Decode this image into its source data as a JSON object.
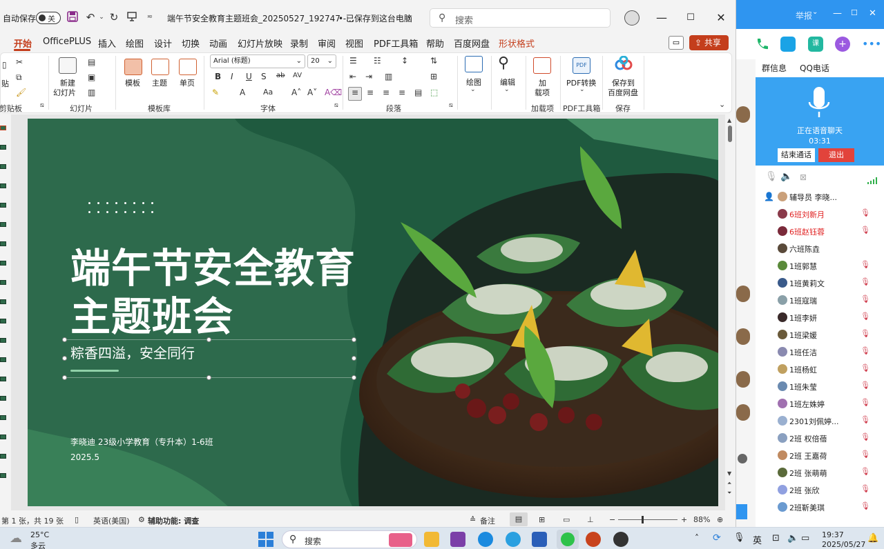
{
  "titlebar": {
    "autosave_label": "自动保存",
    "autosave_state": "关",
    "doc_title": "端午节安全教育主题班会_20250527_192747  -...",
    "save_status": "• 已保存到这台电脑",
    "search_placeholder": "搜索"
  },
  "tabs": [
    "开始",
    "OfficePLUS",
    "插入",
    "绘图",
    "设计",
    "切换",
    "动画",
    "幻灯片放映",
    "录制",
    "审阅",
    "视图",
    "PDF工具箱",
    "帮助",
    "百度网盘",
    "形状格式"
  ],
  "share_label": "共享",
  "ribbon": {
    "paste_label": "贴",
    "new_slide_label": "新建",
    "new_slide_label2": "幻灯片",
    "template_label": "模板",
    "theme_label": "主题",
    "single_page_label": "单页",
    "font_name": "Arial (标题)",
    "font_size": "20",
    "drawing_label": "绘图",
    "edit_label": "编辑",
    "addin_label": "加",
    "addin_label2": "载项",
    "pdf_convert_label": "PDF转换",
    "save_baidu_label": "保存到",
    "save_baidu_label2": "百度网盘",
    "groups": {
      "clipboard": "剪贴板",
      "slides": "幻灯片",
      "templates": "模板库",
      "font": "字体",
      "paragraph": "段落",
      "addins": "加载项",
      "pdf": "PDF工具箱",
      "save": "保存"
    }
  },
  "slide": {
    "title_line1": "端午节安全教育",
    "title_line2": "主题班会",
    "subtitle": "粽香四溢，安全同行",
    "author": "李晓迪 23级小学教育（专升本）1-6班",
    "date": "2025.5"
  },
  "statusbar": {
    "slide_info": "第 1 张，共 19 张",
    "language": "英语(美国)",
    "accessibility": "辅助功能: 调查",
    "notes_label": "备注",
    "zoom": "88%"
  },
  "qq": {
    "report_label": "举报",
    "tab_group_info": "群信息",
    "tab_qq_call": "QQ电话",
    "voice_status": "正在语音聊天",
    "voice_timer": "03:31",
    "end_call_label": "结束通话",
    "exit_label": "退出",
    "members": [
      {
        "name": "辅导员 李晓...",
        "red": false,
        "muted": false
      },
      {
        "name": "6班刘新月",
        "red": true,
        "muted": true
      },
      {
        "name": "6班赵钰蓉",
        "red": true,
        "muted": true
      },
      {
        "name": "六班陈垚",
        "red": false,
        "muted": false
      },
      {
        "name": "1班郭慧",
        "red": false,
        "muted": true
      },
      {
        "name": "1班黄莉文",
        "red": false,
        "muted": true
      },
      {
        "name": "1班寇瑞",
        "red": false,
        "muted": true
      },
      {
        "name": "1班李妍",
        "red": false,
        "muted": true
      },
      {
        "name": "1班梁媛",
        "red": false,
        "muted": true
      },
      {
        "name": "1班任洁",
        "red": false,
        "muted": true
      },
      {
        "name": "1班杨虹",
        "red": false,
        "muted": true
      },
      {
        "name": "1班朱莹",
        "red": false,
        "muted": true
      },
      {
        "name": "1班左姝婷",
        "red": false,
        "muted": true
      },
      {
        "name": "2301刘佩婷...",
        "red": false,
        "muted": true
      },
      {
        "name": "2班 权倍蓓",
        "red": false,
        "muted": true
      },
      {
        "name": "2班 王嘉荷",
        "red": false,
        "muted": true
      },
      {
        "name": "2班 张萌萌",
        "red": false,
        "muted": true
      },
      {
        "name": "2班 张欣",
        "red": false,
        "muted": true
      },
      {
        "name": "2班靳美琪",
        "red": false,
        "muted": true
      }
    ]
  },
  "taskbar": {
    "weather_temp": "25°C",
    "weather_desc": "多云",
    "search_label": "搜索",
    "ime_label": "英",
    "time": "19:37",
    "date": "2025/05/27"
  },
  "colors": {
    "accent": "#c43e1c",
    "slide_green": "#2d6a4c",
    "qq_blue": "#2f95f0"
  }
}
